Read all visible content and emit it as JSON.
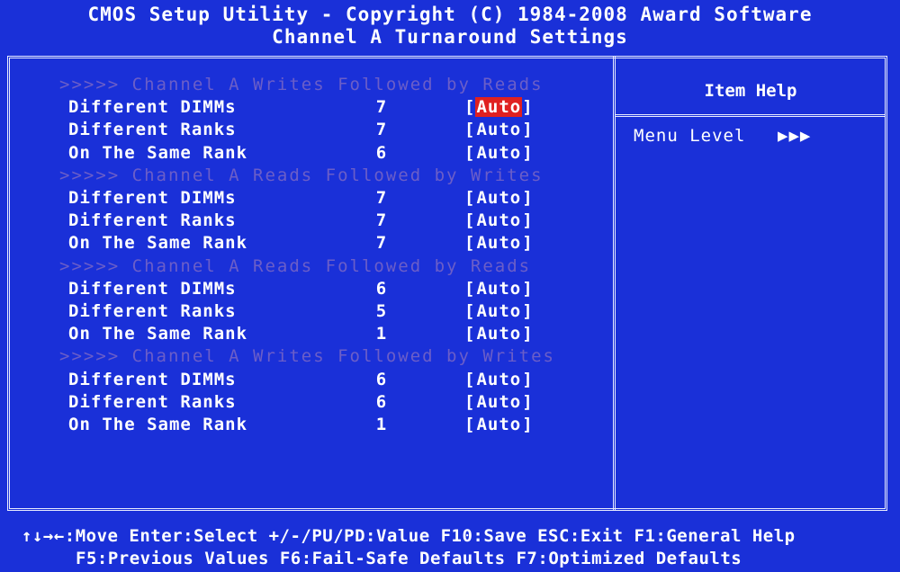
{
  "header": {
    "title": "CMOS Setup Utility - Copyright (C) 1984-2008 Award Software",
    "subtitle": "Channel A Turnaround Settings"
  },
  "help_panel": {
    "title": "Item Help",
    "menu_level_label": "Menu Level",
    "menu_level_arrows": "▶▶▶"
  },
  "sections": [
    {
      "heading": ">>>>>  Channel A Writes Followed by Reads",
      "items": [
        {
          "label": "Different DIMMs",
          "value": "7",
          "option": "Auto",
          "selected": true
        },
        {
          "label": "Different Ranks",
          "value": "7",
          "option": "Auto",
          "selected": false
        },
        {
          "label": "On The Same Rank",
          "value": "6",
          "option": "Auto",
          "selected": false
        }
      ]
    },
    {
      "heading": ">>>>>  Channel A Reads Followed by Writes",
      "items": [
        {
          "label": "Different DIMMs",
          "value": "7",
          "option": "Auto",
          "selected": false
        },
        {
          "label": "Different Ranks",
          "value": "7",
          "option": "Auto",
          "selected": false
        },
        {
          "label": "On The Same Rank",
          "value": "7",
          "option": "Auto",
          "selected": false
        }
      ]
    },
    {
      "heading": ">>>>>  Channel A Reads Followed by Reads",
      "items": [
        {
          "label": "Different DIMMs",
          "value": "6",
          "option": "Auto",
          "selected": false
        },
        {
          "label": "Different Ranks",
          "value": "5",
          "option": "Auto",
          "selected": false
        },
        {
          "label": "On The Same Rank",
          "value": "1",
          "option": "Auto",
          "selected": false
        }
      ]
    },
    {
      "heading": ">>>>>  Channel A Writes Followed by Writes",
      "items": [
        {
          "label": "Different DIMMs",
          "value": "6",
          "option": "Auto",
          "selected": false
        },
        {
          "label": "Different Ranks",
          "value": "6",
          "option": "Auto",
          "selected": false
        },
        {
          "label": "On The Same Rank",
          "value": "1",
          "option": "Auto",
          "selected": false
        }
      ]
    }
  ],
  "footer": {
    "line1": "↑↓→←:Move  Enter:Select  +/-/PU/PD:Value  F10:Save  ESC:Exit  F1:General Help",
    "line2": "F5:Previous Values  F6:Fail-Safe Defaults  F7:Optimized Defaults"
  },
  "colors": {
    "background": "#1a30d8",
    "text": "#ffffff",
    "section_heading": "#6b5ec8",
    "selection_highlight": "#e02020"
  }
}
